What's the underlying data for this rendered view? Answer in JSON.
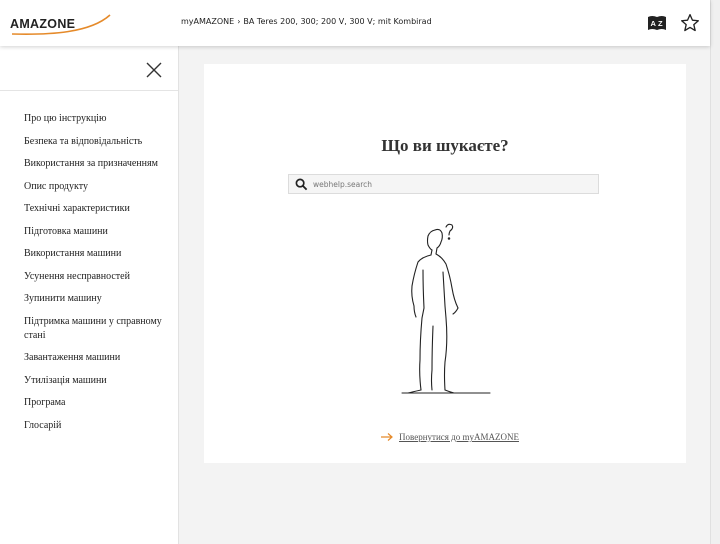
{
  "header": {
    "logo_text": "AMAZONE",
    "breadcrumb": [
      "myAMAZONE",
      "BA Teres 200, 300; 200 V, 300 V; mit Kombirad"
    ],
    "breadcrumb_sep": "›",
    "icons": [
      "language-az-icon",
      "star-icon"
    ]
  },
  "sidebar": {
    "close_icon": "close-icon",
    "items": [
      {
        "label": "Про цю інструкцію"
      },
      {
        "label": "Безпека та відповідальність"
      },
      {
        "label": "Використання за призначенням"
      },
      {
        "label": "Опис продукту"
      },
      {
        "label": "Технічні характеристики"
      },
      {
        "label": "Підготовка машини"
      },
      {
        "label": "Використання машини"
      },
      {
        "label": "Усунення несправностей"
      },
      {
        "label": "Зупинити машину"
      },
      {
        "label": "Підтримка машини у справному стані"
      },
      {
        "label": "Завантаження машини"
      },
      {
        "label": "Утилізація машини"
      },
      {
        "label": "Програма"
      },
      {
        "label": "Глосарій"
      }
    ]
  },
  "main": {
    "title": "Що ви шукаєте?",
    "search": {
      "placeholder": "webhelp.search",
      "value": ""
    },
    "illustration_icon": "thinking-person-question-icon",
    "back_link": "Повернутися до myAMAZONE"
  },
  "colors": {
    "accent": "#e58a2a",
    "text": "#222222",
    "background": "#f3f3f3"
  }
}
